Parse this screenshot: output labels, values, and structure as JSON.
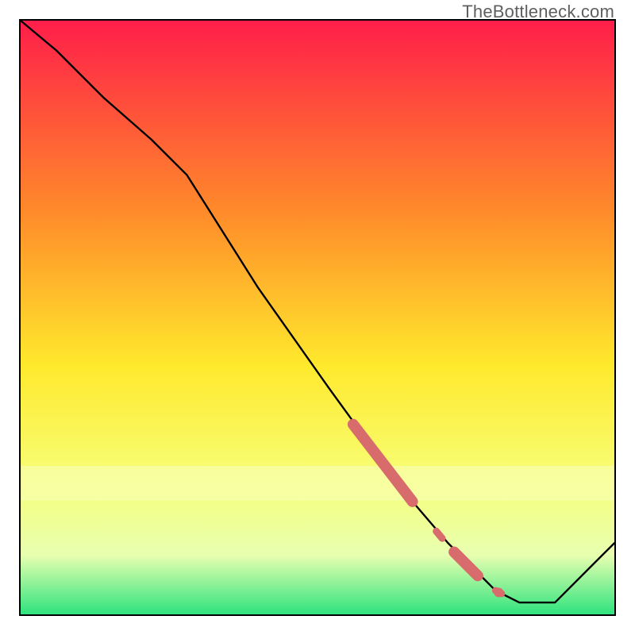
{
  "watermark": "TheBottleneck.com",
  "colors": {
    "top": "#ff1e4a",
    "mid_upper": "#ff8a2a",
    "mid": "#ffe92c",
    "mid_lower": "#f6ff7a",
    "band_pale": "#e8ffb0",
    "bottom": "#2fe37e",
    "line": "#000000",
    "marker": "#d86c6c"
  },
  "chart_data": {
    "type": "line",
    "title": "",
    "xlabel": "",
    "ylabel": "",
    "xlim": [
      0,
      100
    ],
    "ylim": [
      0,
      100
    ],
    "x": [
      0,
      6,
      14,
      22,
      28,
      40,
      52,
      60,
      66,
      72,
      76,
      80,
      84,
      90,
      96,
      100
    ],
    "values": [
      100,
      95,
      87,
      80,
      74,
      55,
      38,
      27,
      19,
      12,
      8,
      4,
      2,
      2,
      8,
      12
    ],
    "highlight_segments": [
      {
        "x0": 56,
        "y0": 32,
        "x1": 66,
        "y1": 19,
        "thick": true
      },
      {
        "x0": 70,
        "y0": 14,
        "x1": 71,
        "y1": 12.8,
        "thick": false
      },
      {
        "x0": 73,
        "y0": 10.5,
        "x1": 77,
        "y1": 6.5,
        "thick": true
      },
      {
        "x0": 80,
        "y0": 4,
        "x1": 81,
        "y1": 3.5,
        "thick": false
      }
    ],
    "highlight_points": [
      {
        "x": 80.5,
        "y": 3.7
      }
    ]
  }
}
